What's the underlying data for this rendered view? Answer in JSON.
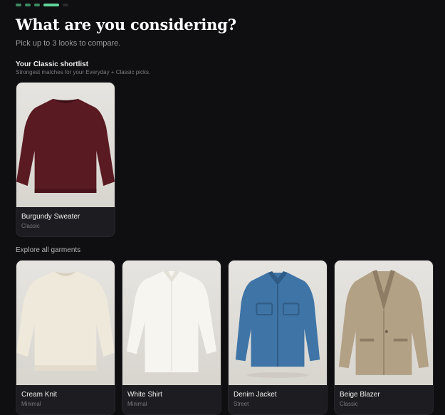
{
  "title": "What are you considering?",
  "subtitle": "Pick up to 3 looks to compare.",
  "progress": {
    "total_steps": 5,
    "current_step": 4
  },
  "shortlist": {
    "title": "Your Classic shortlist",
    "subtitle": "Strongest matches for your Everyday + Classic picks.",
    "items": [
      {
        "name": "Burgundy Sweater",
        "tag": "Classic",
        "icon": "burgundy-sweater-image"
      }
    ]
  },
  "explore": {
    "title": "Explore all garments",
    "items": [
      {
        "name": "Cream Knit",
        "tag": "Minimal",
        "icon": "cream-knit-image"
      },
      {
        "name": "White Shirt",
        "tag": "Minimal",
        "icon": "white-shirt-image"
      },
      {
        "name": "Denim Jacket",
        "tag": "Street",
        "icon": "denim-jacket-image"
      },
      {
        "name": "Beige Blazer",
        "tag": "Classic",
        "icon": "beige-blazer-image"
      }
    ]
  },
  "colors": {
    "background": "#0f0f11",
    "accent": "#5fd49a",
    "card": "#1d1d21",
    "burgundy": "#5a1a22",
    "cream": "#efe9dc",
    "white": "#f7f5f0",
    "denim": "#3f74a6",
    "beige": "#b3a186"
  }
}
